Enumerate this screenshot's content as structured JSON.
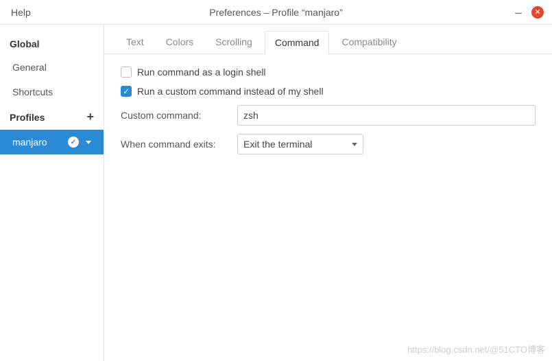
{
  "titlebar": {
    "help": "Help",
    "title": "Preferences – Profile “manjaro”"
  },
  "sidebar": {
    "global_label": "Global",
    "general_label": "General",
    "shortcuts_label": "Shortcuts",
    "profiles_label": "Profiles",
    "profiles": [
      "manjaro"
    ],
    "active_profile": "manjaro"
  },
  "tabs": {
    "items": [
      "Text",
      "Colors",
      "Scrolling",
      "Command",
      "Compatibility"
    ],
    "active": "Command"
  },
  "command_panel": {
    "login_shell_label": "Run command as a login shell",
    "login_shell_checked": false,
    "custom_cmd_checkbox_label": "Run a custom command instead of my shell",
    "custom_cmd_checked": true,
    "custom_cmd_label": "Custom command:",
    "custom_cmd_value": "zsh",
    "when_exits_label": "When command exits:",
    "when_exits_value": "Exit the terminal"
  },
  "watermark": "https://blog.csdn.net/@51CTO博客"
}
